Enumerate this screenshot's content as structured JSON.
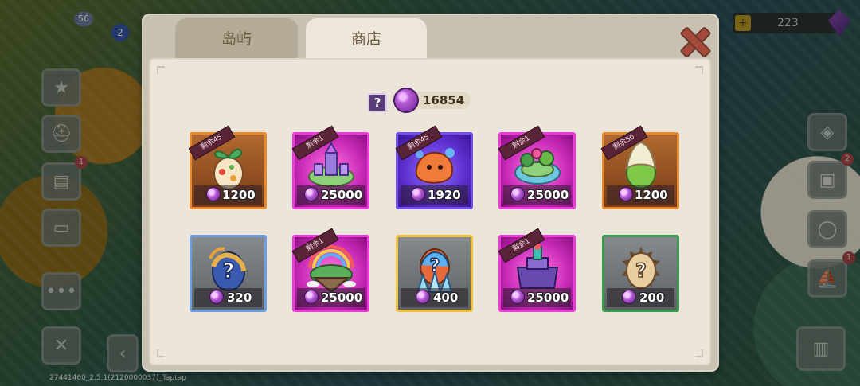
{
  "background": {
    "player_level": "56",
    "map_level": "2",
    "top_currency_value": "223",
    "side_badges": [
      "1",
      "2",
      "1"
    ],
    "build_label": "27441460_2.5.1(2120000037)_Taptap"
  },
  "modal": {
    "tabs": [
      {
        "label": "岛屿",
        "active": false
      },
      {
        "label": "商店",
        "active": true
      }
    ],
    "close_icon": "close-icon",
    "help_label": "?",
    "balance": "16854",
    "items": [
      {
        "tag": "剩余45",
        "price": "1200",
        "frame": "orange",
        "icon": "sprout-egg-icon"
      },
      {
        "tag": "剩余1",
        "price": "25000",
        "frame": "magenta",
        "icon": "castle-island-icon"
      },
      {
        "tag": "剩余45",
        "price": "1920",
        "frame": "purple",
        "icon": "fire-creature-icon"
      },
      {
        "tag": "剩余1",
        "price": "25000",
        "frame": "magenta",
        "icon": "garden-island-icon"
      },
      {
        "tag": "剩余50",
        "price": "1200",
        "frame": "orange",
        "icon": "leaf-egg-icon"
      },
      {
        "tag": "",
        "price": "320",
        "frame": "blue",
        "icon": "mystery-blue-egg-icon"
      },
      {
        "tag": "剩余1",
        "price": "25000",
        "frame": "magenta",
        "icon": "rainbow-island-icon"
      },
      {
        "tag": "",
        "price": "400",
        "frame": "gold",
        "icon": "mystery-crystal-egg-icon"
      },
      {
        "tag": "剩余1",
        "price": "25000",
        "frame": "magenta",
        "icon": "tower-island-icon"
      },
      {
        "tag": "",
        "price": "200",
        "frame": "green",
        "icon": "mystery-spiked-egg-icon"
      }
    ]
  },
  "colors": {
    "accent_close": "#a5493a",
    "currency": "#b85cd8"
  }
}
